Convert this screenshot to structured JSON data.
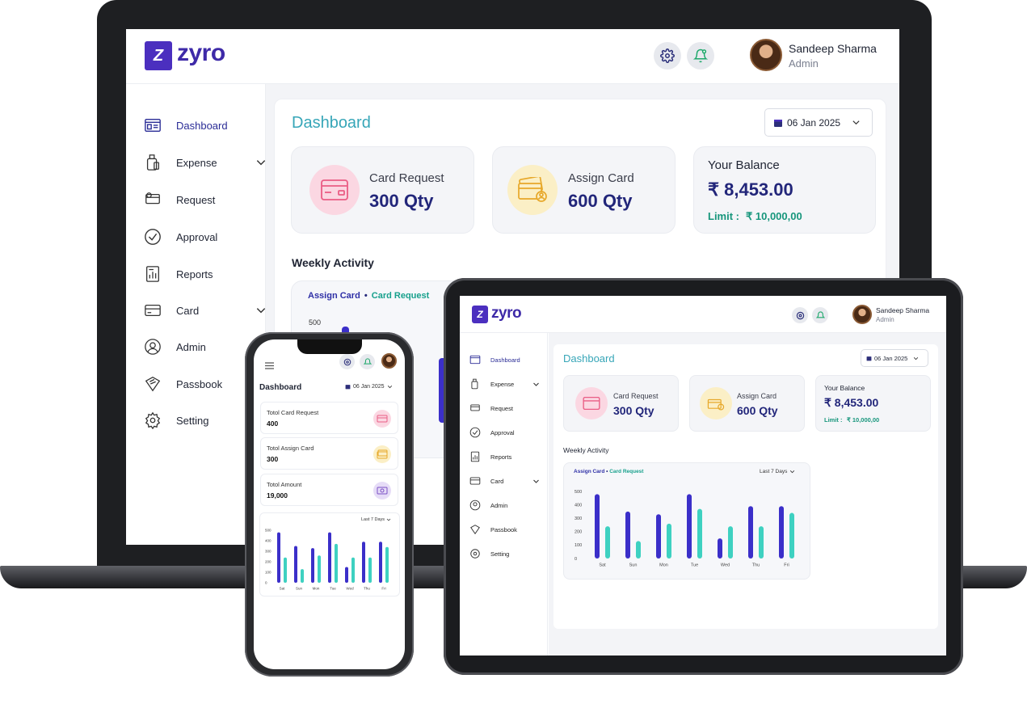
{
  "brand": {
    "name": "zyro",
    "mark": "Z"
  },
  "colors": {
    "brand": "#4b2fbf",
    "navy": "#22267a",
    "teal": "#37a6b8",
    "green": "#17967c",
    "bar_primary": "#3b2fc9",
    "bar_secondary": "#3ed1c1"
  },
  "user": {
    "name": "Sandeep Sharma",
    "role": "Admin"
  },
  "header_icons": [
    "gear-icon",
    "bell-icon"
  ],
  "sidebar": {
    "items": [
      {
        "label": "Dashboard",
        "icon": "dashboard-icon",
        "active": true
      },
      {
        "label": "Expense",
        "icon": "expense-icon",
        "has_dropdown": true
      },
      {
        "label": "Request",
        "icon": "request-icon"
      },
      {
        "label": "Approval",
        "icon": "check-circle-icon"
      },
      {
        "label": "Reports",
        "icon": "reports-icon"
      },
      {
        "label": "Card",
        "icon": "card-icon",
        "has_dropdown": true
      },
      {
        "label": "Admin",
        "icon": "user-icon"
      },
      {
        "label": "Passbook",
        "icon": "passbook-icon"
      },
      {
        "label": "Setting",
        "icon": "gear-icon"
      }
    ]
  },
  "dashboard": {
    "title": "Dashboard",
    "date": "06 Jan 2025",
    "cards": {
      "card_request": {
        "label": "Card Request",
        "value": "300 Qty"
      },
      "assign_card": {
        "label": "Assign Card",
        "value": "600 Qty"
      },
      "balance": {
        "label": "Your Balance",
        "value": "₹ 8,453.00",
        "limit_label": "Limit :",
        "limit_value": "₹ 10,000,00"
      }
    },
    "weekly": {
      "title": "Weekly Activity",
      "legend": {
        "first": "Assign Card",
        "sep": "•",
        "second": "Card Request"
      },
      "range": "Last 7 Days"
    }
  },
  "phone": {
    "title": "Dashboard",
    "date": "06 Jan 2025",
    "rows": [
      {
        "label": "Totol Card Request",
        "value": "400"
      },
      {
        "label": "Totol Assign Card",
        "value": "300"
      },
      {
        "label": "Totol Amount",
        "value": "19,000"
      }
    ],
    "range": "Last 7 Days"
  },
  "chart_data": {
    "type": "bar",
    "categories": [
      "Sat",
      "Sun",
      "Mon",
      "Tue",
      "Wed",
      "Thu",
      "Fri"
    ],
    "series": [
      {
        "name": "Assign Card",
        "values": [
          480,
          350,
          330,
          480,
          150,
          390,
          390
        ]
      },
      {
        "name": "Card Request",
        "values": [
          240,
          130,
          260,
          370,
          240,
          240,
          340
        ]
      }
    ],
    "yticks": [
      "500",
      "400",
      "300",
      "200",
      "100",
      "0"
    ],
    "ylim": [
      0,
      500
    ]
  }
}
